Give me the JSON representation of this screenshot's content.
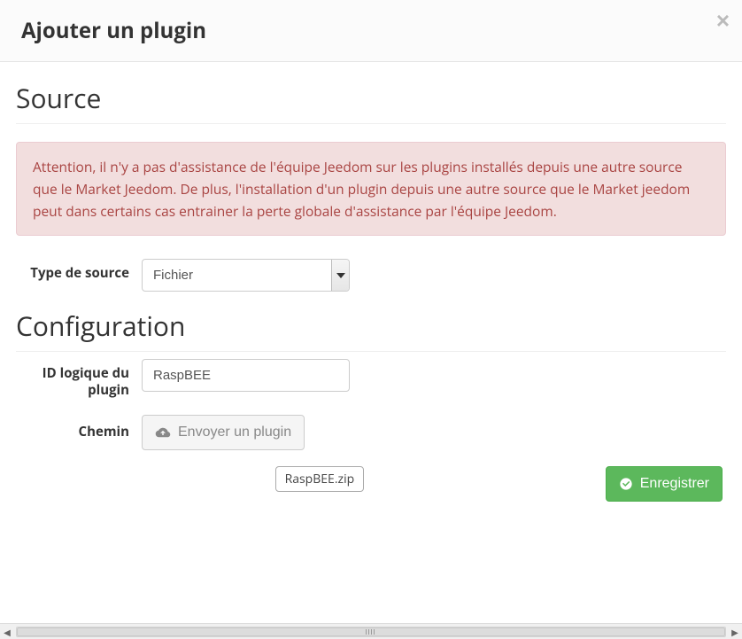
{
  "modal": {
    "title": "Ajouter un plugin"
  },
  "sections": {
    "source": "Source",
    "configuration": "Configuration"
  },
  "alert": {
    "text": "Attention, il n'y a pas d'assistance de l'équipe Jeedom sur les plugins installés depuis une autre source que le Market Jeedom. De plus, l'installation d'un plugin depuis une autre source que le Market jeedom peut dans certains cas entrainer la perte globale d'assistance par l'équipe Jeedom."
  },
  "form": {
    "source_type_label": "Type de source",
    "source_type_value": "Fichier",
    "plugin_id_label": "ID logique du plugin",
    "plugin_id_value": "RaspBEE",
    "path_label": "Chemin",
    "upload_button": "Envoyer un plugin",
    "uploaded_file": "RaspBEE.zip"
  },
  "buttons": {
    "save": "Enregistrer"
  }
}
